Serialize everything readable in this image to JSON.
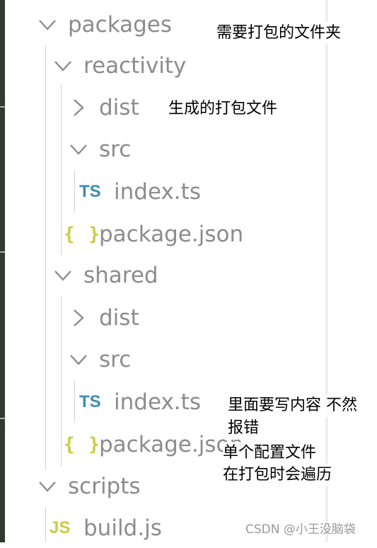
{
  "explorer": {
    "tree": [
      {
        "id": "packages",
        "label": "packages",
        "type": "folder",
        "expanded": true,
        "icon": "chevron-down-icon"
      },
      {
        "id": "reactivity",
        "label": "reactivity",
        "type": "folder",
        "expanded": true,
        "icon": "chevron-down-icon"
      },
      {
        "id": "reactivity-dist",
        "label": "dist",
        "type": "folder",
        "expanded": false,
        "icon": "chevron-right-icon"
      },
      {
        "id": "reactivity-src",
        "label": "src",
        "type": "folder",
        "expanded": true,
        "icon": "chevron-down-icon"
      },
      {
        "id": "reactivity-index",
        "label": "index.ts",
        "type": "file",
        "badge": "TS",
        "icon": "typescript-file-icon"
      },
      {
        "id": "reactivity-package",
        "label": "package.json",
        "type": "file",
        "badge": "{ }",
        "icon": "json-file-icon"
      },
      {
        "id": "shared",
        "label": "shared",
        "type": "folder",
        "expanded": true,
        "icon": "chevron-down-icon"
      },
      {
        "id": "shared-dist",
        "label": "dist",
        "type": "folder",
        "expanded": false,
        "icon": "chevron-right-icon"
      },
      {
        "id": "shared-src",
        "label": "src",
        "type": "folder",
        "expanded": true,
        "icon": "chevron-down-icon"
      },
      {
        "id": "shared-index",
        "label": "index.ts",
        "type": "file",
        "badge": "TS",
        "icon": "typescript-file-icon"
      },
      {
        "id": "shared-package",
        "label": "package.json",
        "type": "file",
        "badge": "{ }",
        "icon": "json-file-icon"
      },
      {
        "id": "scripts",
        "label": "scripts",
        "type": "folder",
        "expanded": true,
        "icon": "chevron-down-icon"
      },
      {
        "id": "build",
        "label": "build.js",
        "type": "file",
        "badge": "JS",
        "icon": "javascript-file-icon"
      }
    ]
  },
  "annotations": {
    "packages_note": "需要打包的文件夹",
    "dist_note": "生成的打包文件",
    "index_note_line1": "里面要写内容 不然",
    "index_note_line2": "报错",
    "package_note_line1": "单个配置文件",
    "package_note_line2": "在打包时会遍历"
  },
  "watermark": "CSDN @小王没脑袋",
  "colors": {
    "label_text": "#8c8c8c",
    "ts_badge": "#3b8eb5",
    "json_badge": "#cbcb41",
    "js_badge": "#cbcb41",
    "annotation_text": "#000000"
  }
}
